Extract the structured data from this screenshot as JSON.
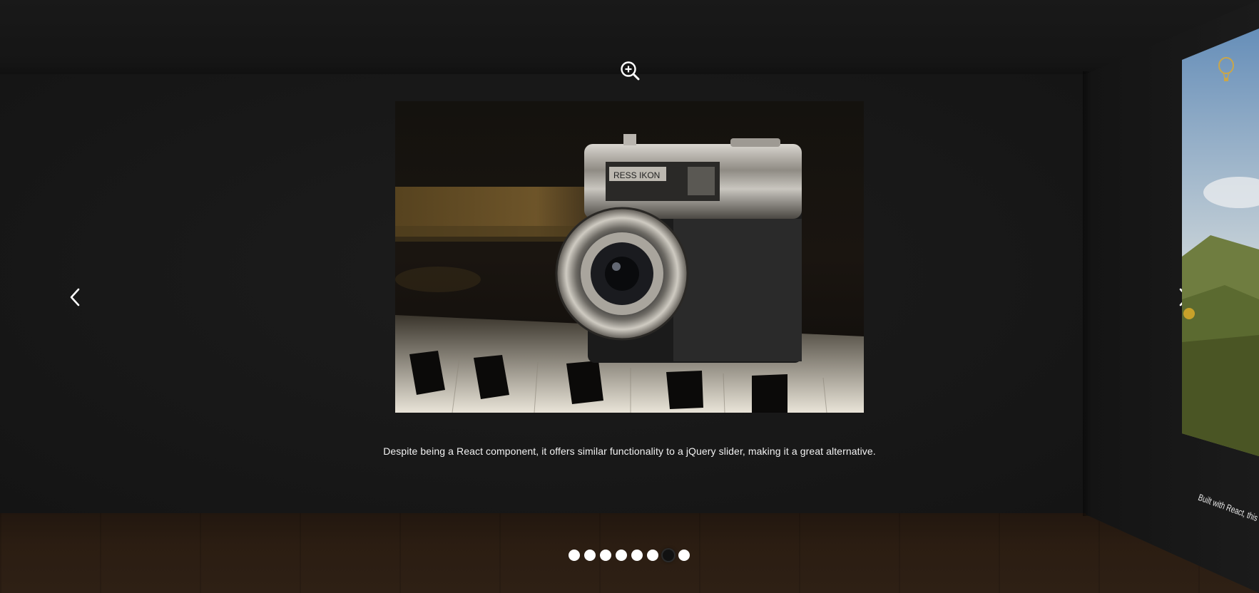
{
  "gallery": {
    "caption": "Despite being a React component, it offers similar functionality to a jQuery slider, making it a great alternative.",
    "side_caption": "Built with React, this com",
    "total_slides": 8,
    "active_slide": 7,
    "dots": [
      {
        "state": "inactive"
      },
      {
        "state": "inactive"
      },
      {
        "state": "inactive"
      },
      {
        "state": "inactive"
      },
      {
        "state": "inactive"
      },
      {
        "state": "inactive"
      },
      {
        "state": "active"
      },
      {
        "state": "inactive"
      }
    ]
  },
  "icons": {
    "zoom": "zoom-in-icon",
    "prev": "chevron-left-icon",
    "next": "chevron-right-icon",
    "side_badge": "balloon-icon"
  },
  "colors": {
    "background": "#121212",
    "floor": "#2b1d12",
    "dot": "#ffffff",
    "dot_active": "#111111",
    "text": "#f2f2f2"
  }
}
